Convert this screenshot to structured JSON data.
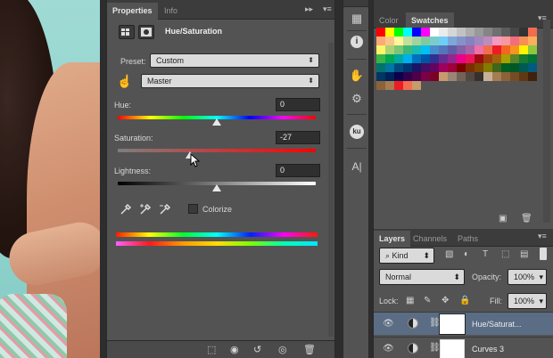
{
  "properties_panel": {
    "tabs": [
      "Properties",
      "Info"
    ],
    "adjustment_title": "Hue/Saturation",
    "preset_label": "Preset:",
    "preset_value": "Custom",
    "channel_value": "Master",
    "hue": {
      "label": "Hue:",
      "value": "0",
      "level": 0
    },
    "saturation": {
      "label": "Saturation:",
      "value": "-27",
      "level": -27
    },
    "lightness": {
      "label": "Lightness:",
      "value": "0",
      "level": 0
    },
    "colorize_label": "Colorize"
  },
  "tool_strip": {
    "icons": [
      "panel-icon",
      "info-icon",
      "hand-icon",
      "adjust-icon",
      "kuler-icon",
      "character-icon"
    ],
    "ku_text": "ku",
    "char_text": "A|"
  },
  "color_panel": {
    "tabs": [
      "Color",
      "Swatches"
    ]
  },
  "swatch_rows": [
    [
      "#ff0000",
      "#ffff00",
      "#00ff00",
      "#00ffff",
      "#0000ff",
      "#ff00ff",
      "#ffffff",
      "#ebebeb",
      "#d6d6d6",
      "#c2c2c2",
      "#adadad",
      "#999999",
      "#858585",
      "#707070",
      "#5c5c5c",
      "#474747",
      "#333333",
      "#f26c4f"
    ],
    [
      "#f9ac7a",
      "#fbc789",
      "#fff799",
      "#c4df9b",
      "#a3d39c",
      "#82ca9c",
      "#7accc8",
      "#6dcff6",
      "#7da7d9",
      "#8393ca",
      "#8781bd",
      "#a187be",
      "#bd8cbf",
      "#f49ac2",
      "#f6989d",
      "#f26d7d",
      "#f68e56",
      "#fbaf5d"
    ],
    [
      "#fff568",
      "#acd373",
      "#7cc576",
      "#3bb878",
      "#1abbb4",
      "#00bff3",
      "#448ccb",
      "#5674b9",
      "#605ca8",
      "#855fa8",
      "#a864a8",
      "#f06ea9",
      "#f26c4f",
      "#ed1c24",
      "#f26522",
      "#f7941d",
      "#fff200",
      "#8dc63f"
    ],
    [
      "#39b54a",
      "#00a651",
      "#00a99d",
      "#00aeef",
      "#0072bc",
      "#0054a6",
      "#2e3192",
      "#662d91",
      "#92278f",
      "#ec008c",
      "#ed145b",
      "#9e0b0f",
      "#a0410d",
      "#a36209",
      "#aba000",
      "#598527",
      "#197b30",
      "#007236"
    ],
    [
      "#00746b",
      "#0076a3",
      "#004a80",
      "#003471",
      "#1b1464",
      "#440e62",
      "#630460",
      "#9e005d",
      "#9e0039",
      "#790000",
      "#7b2e00",
      "#7d4900",
      "#827b00",
      "#406618",
      "#005e20",
      "#005826",
      "#005952",
      "#005b7f"
    ],
    [
      "#003663",
      "#002157",
      "#0d004c",
      "#32004b",
      "#4b0049",
      "#7b0046",
      "#7a0026",
      "#c69c6d",
      "#998675",
      "#736357",
      "#534741",
      "#37302d",
      "#c7b299",
      "#a67c52",
      "#8c6239",
      "#754c24",
      "#603913",
      "#42210b"
    ],
    [
      "#8c6239",
      "#a67c52",
      "#ed1c24",
      "#f26c4f",
      "#c69c6d"
    ]
  ],
  "layers_panel": {
    "tabs": [
      "Layers",
      "Channels",
      "Paths"
    ],
    "filter_label": "Kind",
    "blend_mode": "Normal",
    "opacity_label": "Opacity:",
    "opacity_value": "100%",
    "lock_label": "Lock:",
    "fill_label": "Fill:",
    "fill_value": "100%",
    "layers": [
      {
        "name": "Hue/Saturat...",
        "selected": true
      },
      {
        "name": "Curves 3",
        "selected": false
      }
    ]
  }
}
